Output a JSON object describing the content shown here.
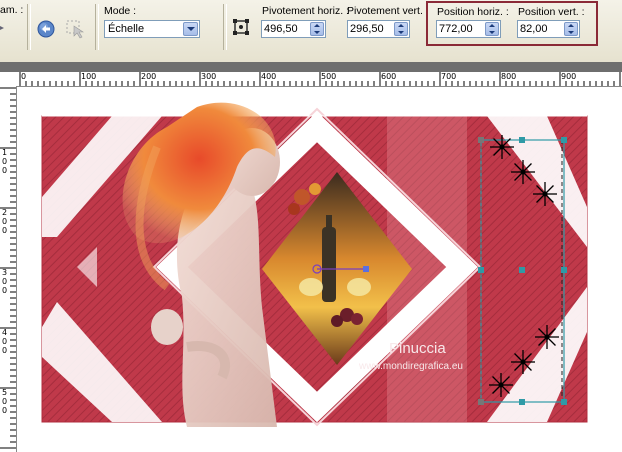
{
  "toolbar": {
    "cut_label": "am. :",
    "mode_label": "Mode :",
    "mode_value": "Échelle",
    "pivot_h_label": "Pivotement horiz. :",
    "pivot_h_value": "496,50",
    "pivot_v_label": "Pivotement vert. :",
    "pivot_v_value": "296,50",
    "pos_h_label": "Position horiz. :",
    "pos_h_value": "772,00",
    "pos_v_label": "Position vert. :",
    "pos_v_value": "82,00",
    "highlight_color": "#8b2a37"
  },
  "ruler": {
    "top_labels": [
      "0",
      "100",
      "200",
      "300",
      "400",
      "500",
      "600",
      "700",
      "800",
      "900"
    ],
    "left_labels": [
      "1\n0\n0",
      "2\n0\n0",
      "3\n0\n0",
      "4\n0\n0",
      "5\n0\n0"
    ]
  },
  "canvas": {
    "bg_red": "#c0394a",
    "watermark_line1": "Pinuccia",
    "watermark_line2": "www.mondiregrafica.eu"
  }
}
